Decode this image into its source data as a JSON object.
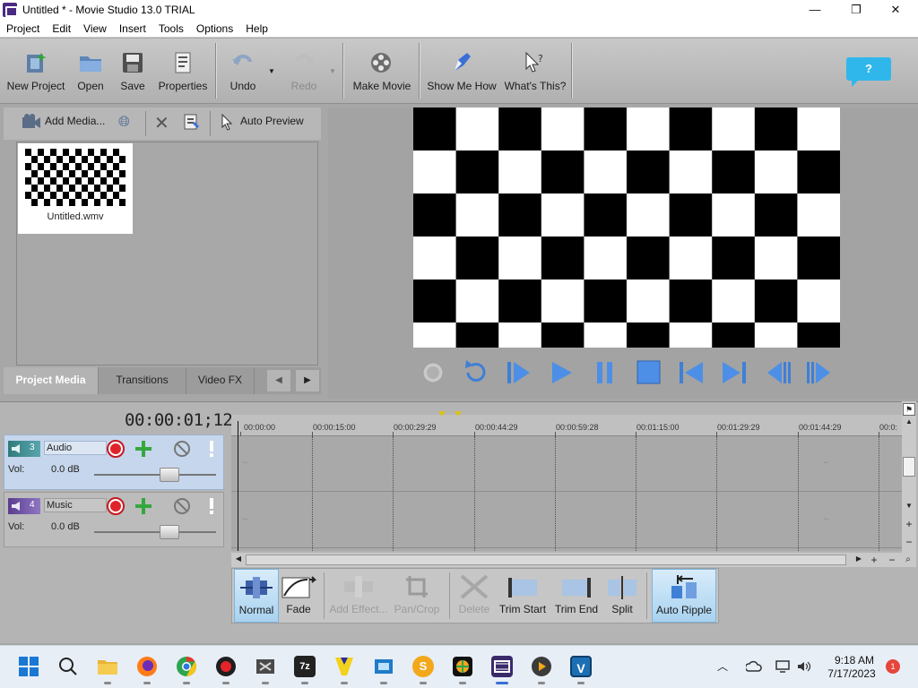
{
  "window": {
    "title": "Untitled * - Movie Studio 13.0 TRIAL",
    "minimize": "—",
    "maximize": "❐",
    "close": "✕"
  },
  "menu": [
    "Project",
    "Edit",
    "View",
    "Insert",
    "Tools",
    "Options",
    "Help"
  ],
  "toolbar": {
    "new_project": "New Project",
    "open": "Open",
    "save": "Save",
    "properties": "Properties",
    "undo": "Undo",
    "redo": "Redo",
    "make_movie": "Make Movie",
    "show_me_how": "Show Me How",
    "whats_this": "What's This?",
    "help": "?"
  },
  "media_panel": {
    "add_media": "Add Media...",
    "auto_preview": "Auto Preview",
    "items": [
      {
        "name": "Untitled.wmv"
      }
    ],
    "tabs": [
      "Project Media",
      "Transitions",
      "Video FX"
    ],
    "active_tab": "Project Media"
  },
  "timeline": {
    "current_time": "00:00:01;12",
    "ruler_labels": [
      "00:00:00",
      "00:00:15:00",
      "00:00:29:29",
      "00:00:44:29",
      "00:00:59:28",
      "00:01:15:00",
      "00:01:29:29",
      "00:01:44:29",
      "00:0:"
    ],
    "tracks": [
      {
        "number": "3",
        "name": "Audio",
        "vol_label": "Vol:",
        "vol_value": "0.0 dB",
        "volume_fraction": 0.64
      },
      {
        "number": "4",
        "name": "Music",
        "vol_label": "Vol:",
        "vol_value": "0.0 dB",
        "volume_fraction": 0.64
      }
    ]
  },
  "edit_toolbar": {
    "normal": "Normal",
    "fade": "Fade",
    "add_effect": "Add Effect...",
    "pan_crop": "Pan/Crop",
    "delete": "Delete",
    "trim_start": "Trim Start",
    "trim_end": "Trim End",
    "split": "Split",
    "auto_ripple": "Auto Ripple"
  },
  "taskbar": {
    "time": "9:18 AM",
    "date": "7/17/2023",
    "notifications": "1",
    "seven_zip": "7z",
    "slides": "S",
    "visio": "V"
  },
  "colors": {
    "accent_blue": "#2fb7ec",
    "record_red": "#e0232b",
    "track_header_blue": "#c6d6ec",
    "panel_gray": "#b4b4b4"
  }
}
